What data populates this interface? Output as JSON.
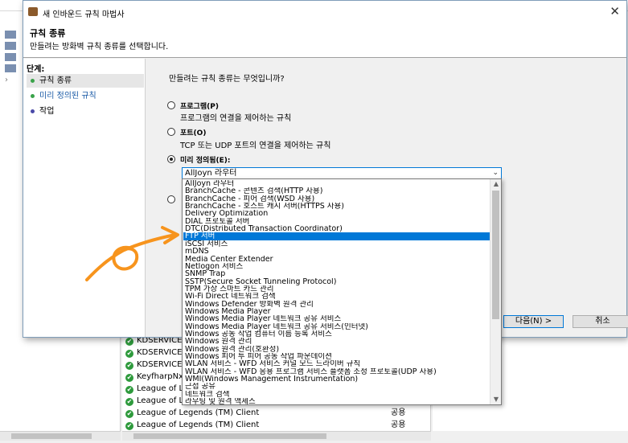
{
  "wizard": {
    "window_title": "새 인바운드 규칙 마법사",
    "header_title": "규칙 종류",
    "header_subtitle": "만들려는 방화벽 규칙 종류를 선택합니다.",
    "steps_title": "단계:",
    "steps": [
      {
        "label": "규칙 종류",
        "color": "#3aa34a"
      },
      {
        "label": "미리 정의된 규칙",
        "color": "#3aa34a"
      },
      {
        "label": "작업",
        "color": "#4a4aa8"
      }
    ],
    "question": "만들려는 규칙 종류는 무엇입니까?",
    "options": [
      {
        "label": "프로그램(P)",
        "description": "프로그램의 연결을 제어하는 규칙"
      },
      {
        "label": "포트(O)",
        "description": "TCP 또는 UDP 포트의 연결을 제어하는 규칙"
      },
      {
        "label": "미리 정의됨(E):",
        "description": ""
      }
    ],
    "combo_value": "AllJoyn 라우터",
    "next_button": "다음(N) >",
    "cancel_button": "취소"
  },
  "dropdown": {
    "selected_index": 7,
    "items": [
      "AllJoyn 라우터",
      "BranchCache - 콘텐츠 검색(HTTP 사용)",
      "BranchCache - 피어 검색(WSD 사용)",
      "BranchCache - 호스트 캐시 서버(HTTPS 사용)",
      "Delivery Optimization",
      "DIAL 프로토콜 서버",
      "DTC(Distributed Transaction Coordinator)",
      "FTP 서버",
      "iSCSI 서비스",
      "mDNS",
      "Media Center Extender",
      "Netlogon 서비스",
      "SNMP Trap",
      "SSTP(Secure Socket Tunneling Protocol)",
      "TPM 가상 스마트 카드 관리",
      "Wi-Fi Direct 네트워크 검색",
      "Windows Defender 방화벽 원격 관리",
      "Windows Media Player",
      "Windows Media Player 네트워크 공유 서비스",
      "Windows Media Player 네트워크 공유 서비스(인터넷)",
      "Windows 공동 작업 컴퓨터 이름 등록 서비스",
      "Windows 원격 관리",
      "Windows 원격 관리(호환성)",
      "Windows 피어 투 피어 공동 작업 파운데이션",
      "WLAN 서비스 - WFD 서비스 커널 모드 드라이버 규칙",
      "WLAN 서비스 - WFD 응용 프로그램 서비스 플랫폼 조정 프로토콜(UDP 사용)",
      "WMI(Windows Management Instrumentation)",
      "근접 공유",
      "네트워크 검색",
      "라우팅 및 원격 액세스"
    ]
  },
  "background_list": [
    {
      "name": "KDSERVICE 9",
      "group": ""
    },
    {
      "name": "KDSERVICE 9",
      "group": ""
    },
    {
      "name": "KDSERVICE 9",
      "group": ""
    },
    {
      "name": "KeyfharpNxB",
      "group": ""
    },
    {
      "name": "League of Leg",
      "group": ""
    },
    {
      "name": "League of Leg",
      "group": ""
    },
    {
      "name": "League of Legends (TM) Client",
      "group": "공용"
    },
    {
      "name": "League of Legends (TM) Client",
      "group": "공용"
    }
  ],
  "icons": {
    "check": "✔",
    "close": "✕",
    "chevron": "⌄",
    "scroll_up": "▲",
    "scroll_down": "▼"
  },
  "colors": {
    "accent": "#0078d7",
    "annotation": "#f7941d",
    "check_green": "#2e9a3c"
  }
}
